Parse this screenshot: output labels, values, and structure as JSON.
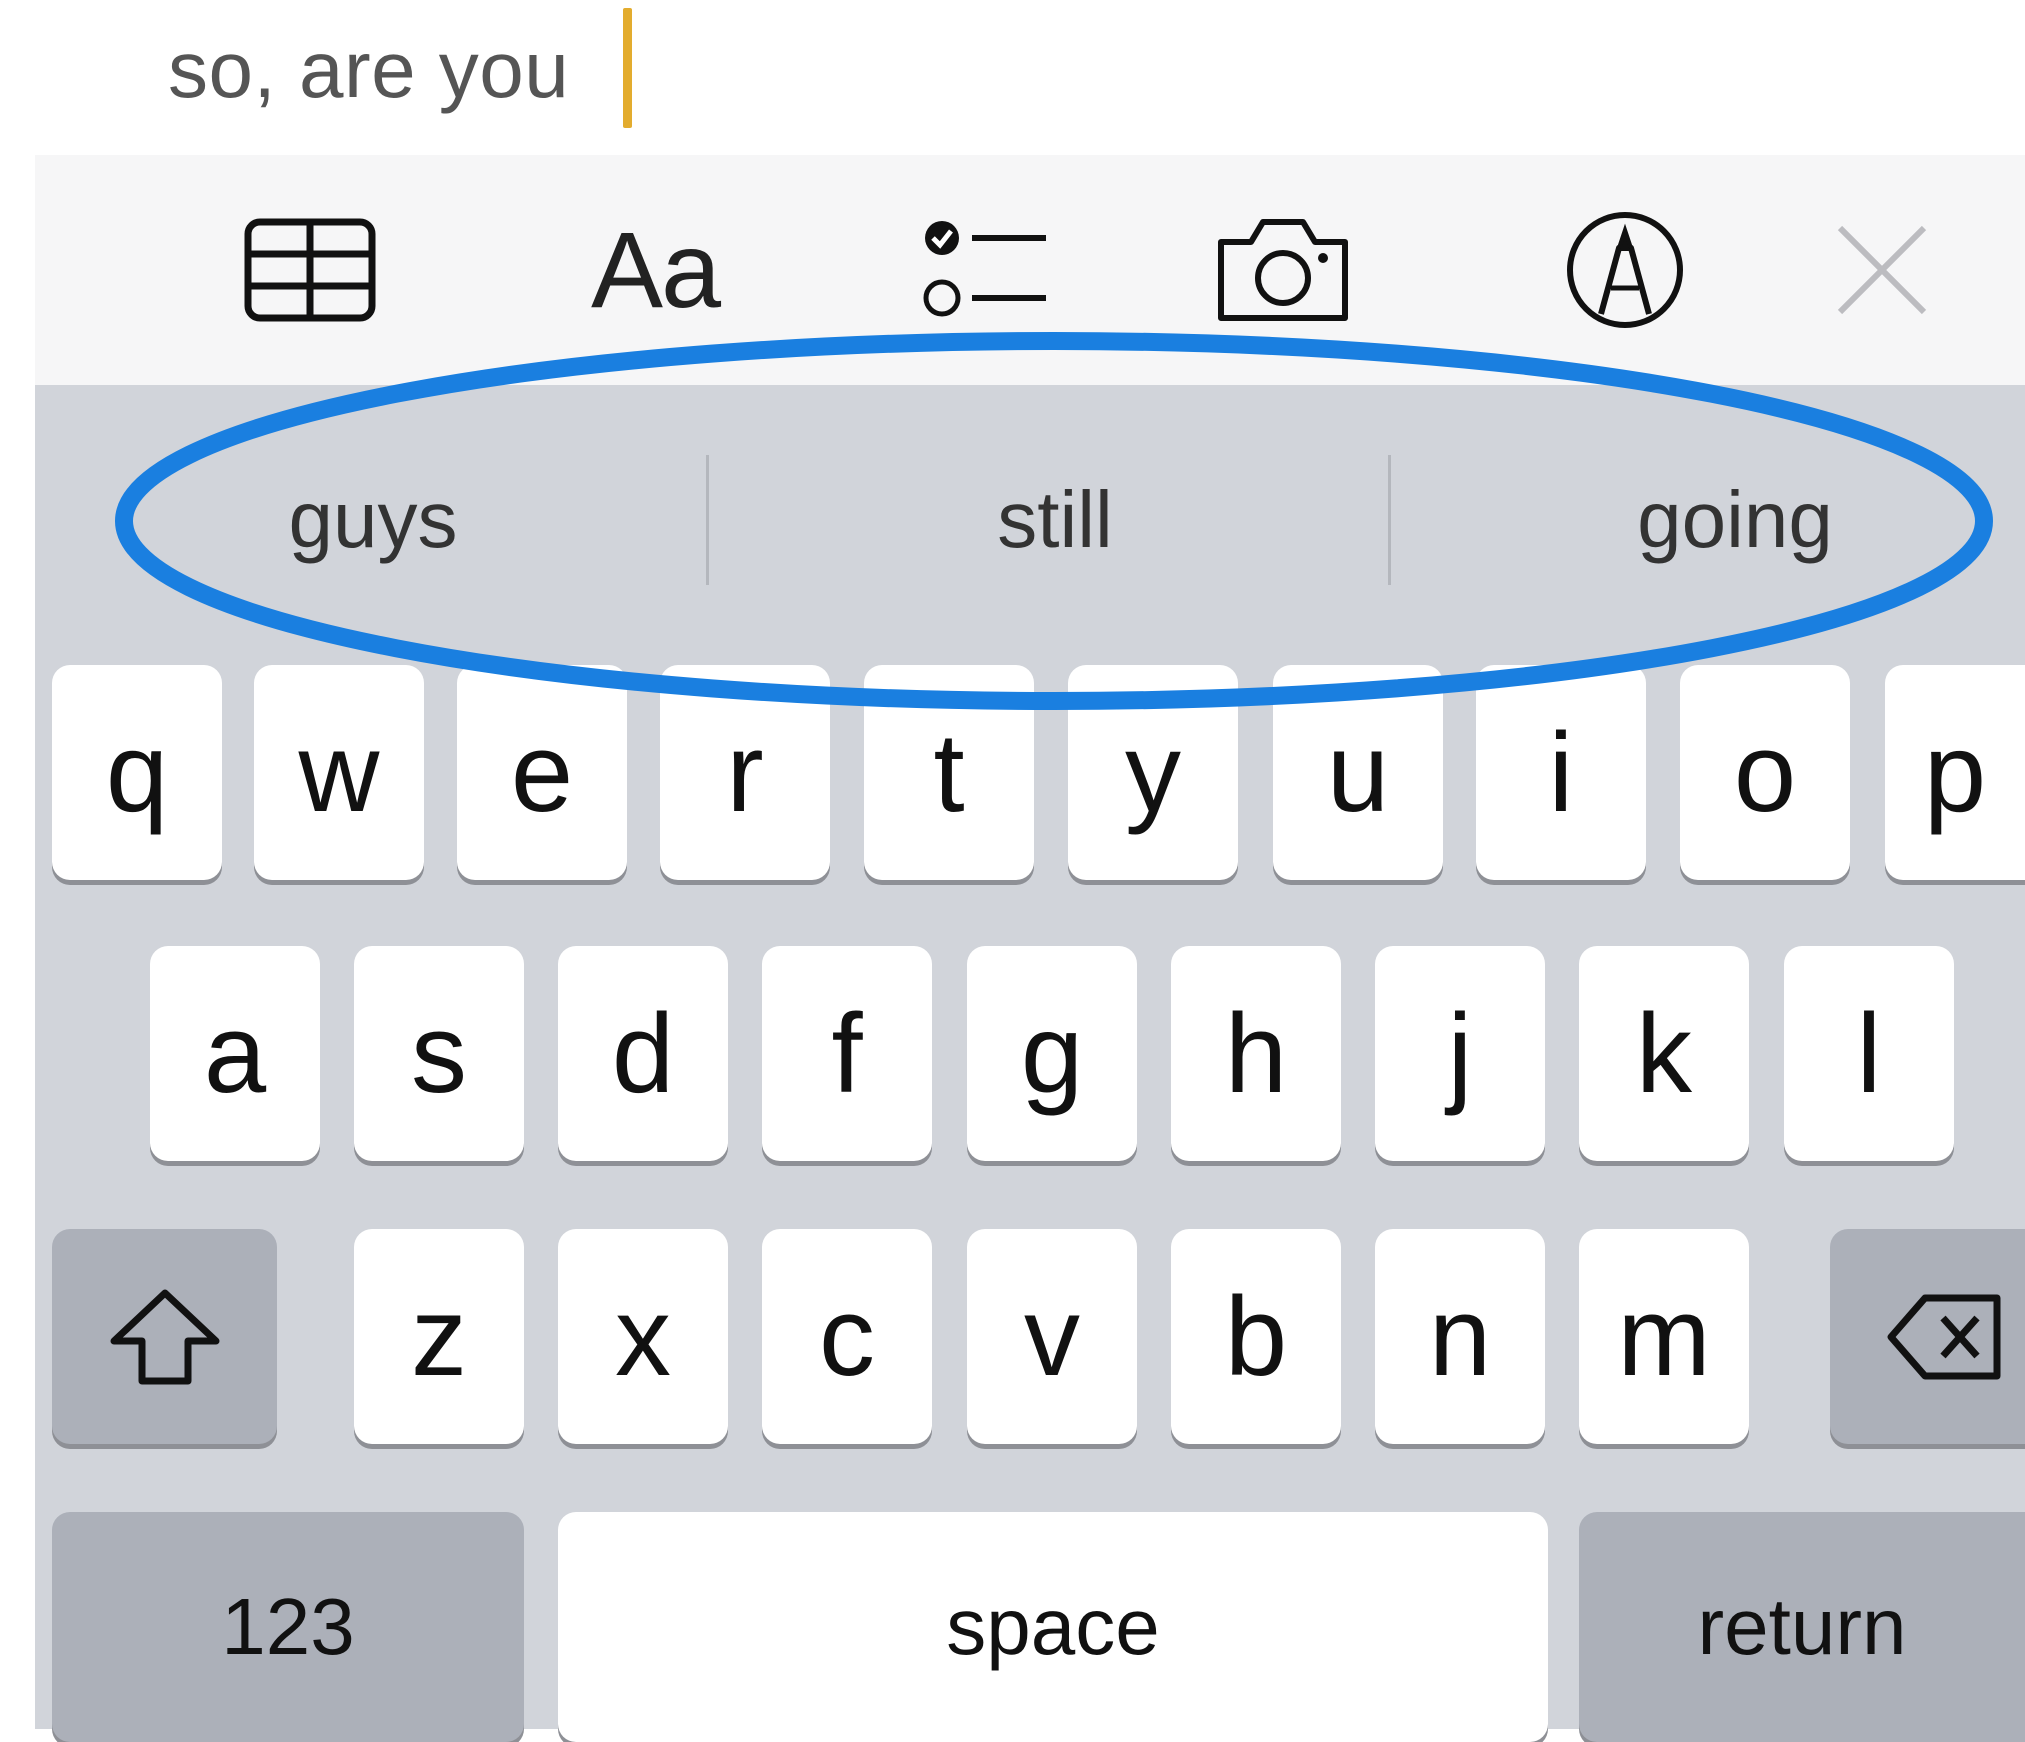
{
  "note": {
    "text": "so, are you"
  },
  "toolbar": {
    "table_icon": "table-icon",
    "format_label": "Aa",
    "checklist_icon": "checklist-icon",
    "camera_icon": "camera-icon",
    "markup_icon": "markup-pen-icon",
    "close_icon": "close-icon"
  },
  "predictive": {
    "suggestions": [
      "guys",
      "still",
      "going"
    ],
    "highlight_color": "#1a7fe0"
  },
  "keyboard": {
    "row1": [
      "q",
      "w",
      "e",
      "r",
      "t",
      "y",
      "u",
      "i",
      "o",
      "p"
    ],
    "row2": [
      "a",
      "s",
      "d",
      "f",
      "g",
      "h",
      "j",
      "k",
      "l"
    ],
    "row3": [
      "z",
      "x",
      "c",
      "v",
      "b",
      "n",
      "m"
    ],
    "shift_icon": "shift-arrow-icon",
    "delete_icon": "backspace-icon",
    "numbers_label": "123",
    "space_label": "space",
    "return_label": "return"
  },
  "colors": {
    "caret": "#e3ac2e",
    "keyboard_bg": "#d1d4da",
    "key_bg": "#ffffff",
    "dark_key_bg": "#acb0b9"
  }
}
